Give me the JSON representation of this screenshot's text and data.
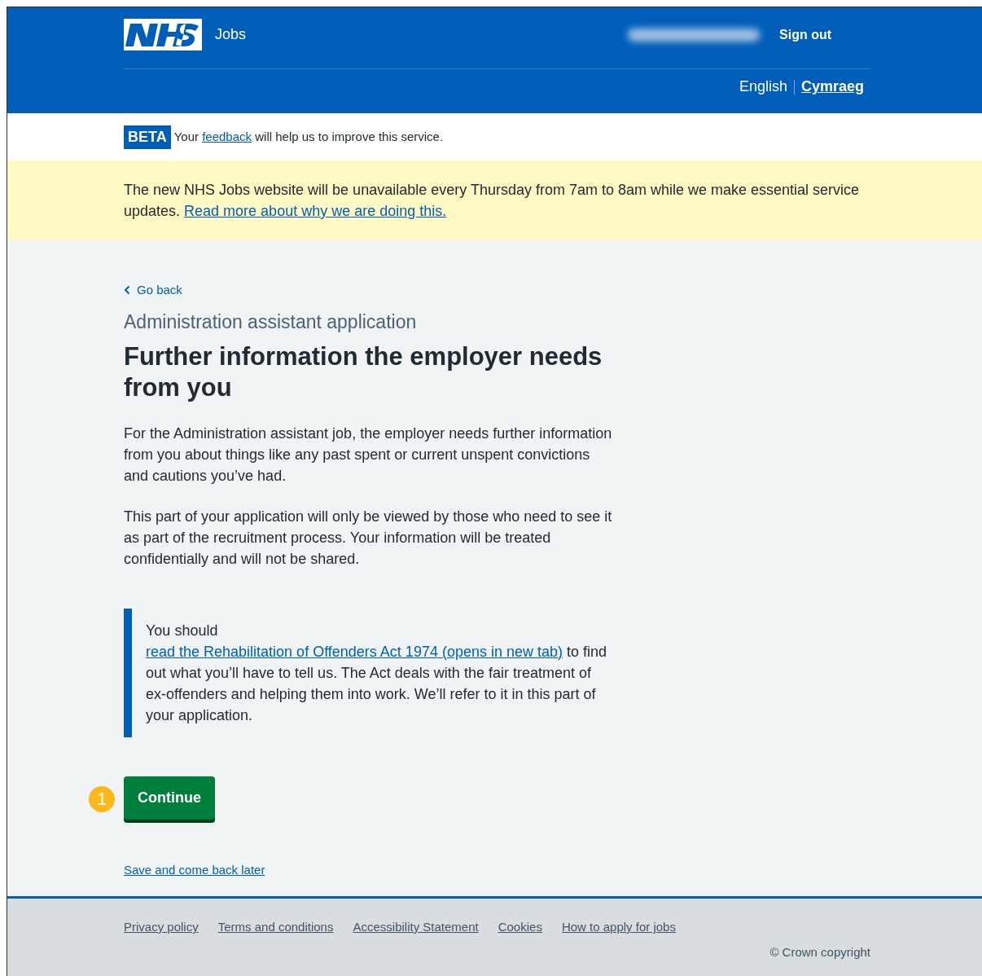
{
  "header": {
    "service": "Jobs",
    "account_link": "Sign out",
    "languages": [
      {
        "label": "English",
        "selected": true
      },
      {
        "label": "Cymraeg",
        "selected": false
      }
    ]
  },
  "phase_banner": {
    "tag": "BETA",
    "before": "Your",
    "link": "feedback",
    "after": "will help us to improve this service."
  },
  "notice": {
    "text": "The new NHS Jobs website will be unavailable every Thursday from 7am to 8am while we make essential service updates.",
    "link": "Read more about why we are doing this."
  },
  "back_link": "Go back",
  "caption": "Administration assistant application",
  "heading": "Further information the employer needs from you",
  "paragraphs": [
    "For the Administration assistant job, the employer needs further information from you about things like any past spent or current unspent convictions and cautions you’ve had.",
    "This part of your application will only be viewed by those who need to see it as part of the recruitment process. Your information will be treated confidentially and will not be shared."
  ],
  "inset": {
    "before": "You should",
    "link": "read the Rehabilitation of Offenders Act 1974 (opens in new tab)",
    "after": "to find out what you’ll have to tell us. The Act deals with the fair treatment of ex-offenders and helping them into work. We’ll refer to it in this part of your application."
  },
  "annotation": "1",
  "continue_button": "Continue",
  "save_link": "Save and come back later",
  "footer": {
    "links": [
      "Privacy policy",
      "Terms and conditions",
      "Accessibility Statement",
      "Cookies",
      "How to apply for jobs"
    ],
    "copyright": "© Crown copyright"
  }
}
